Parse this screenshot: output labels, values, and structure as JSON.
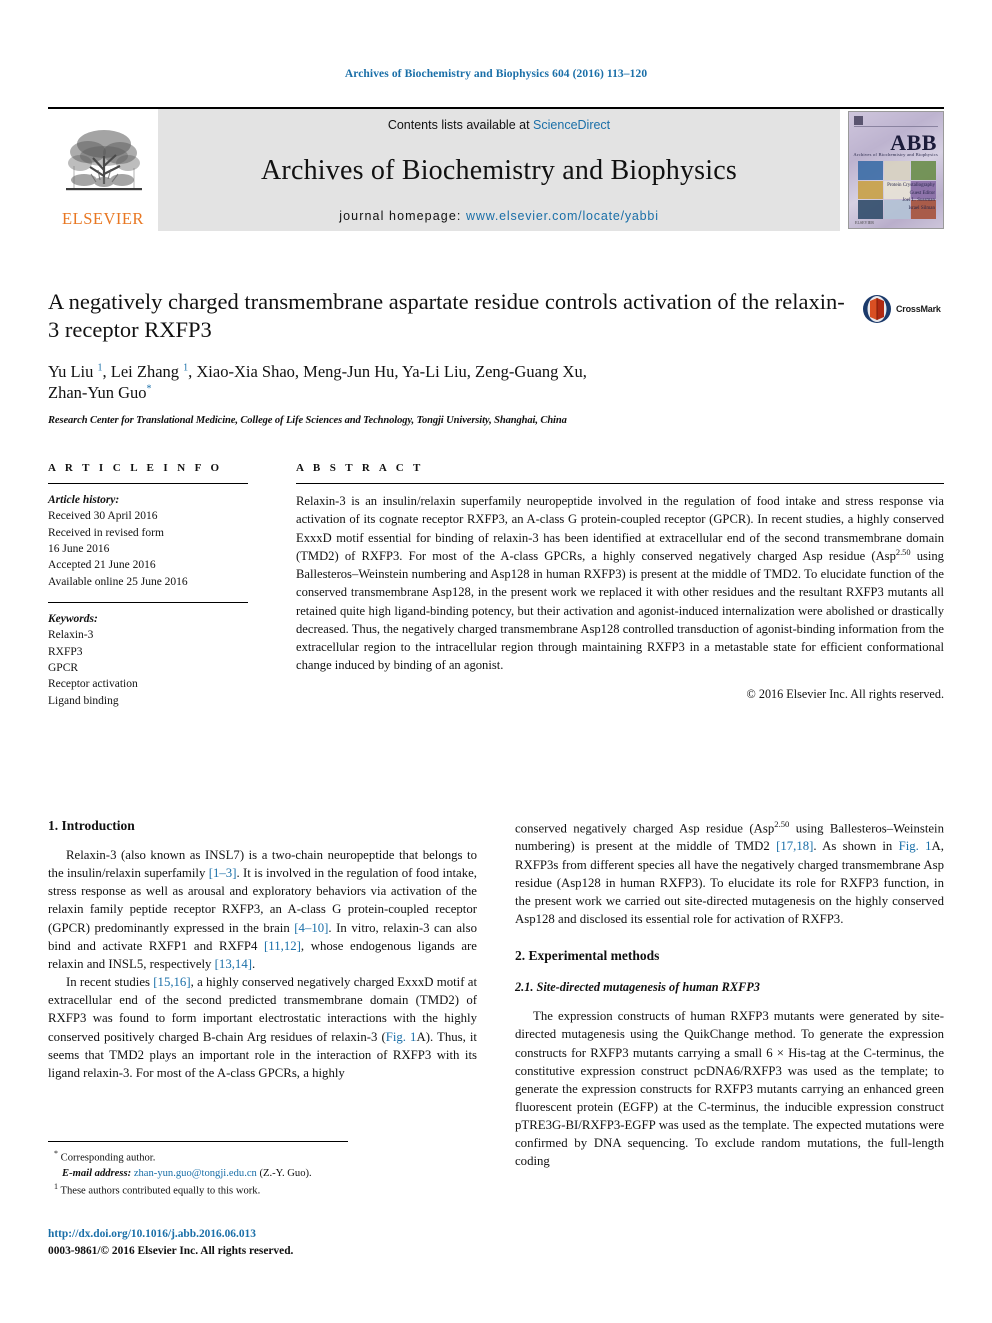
{
  "running_head": "Archives of Biochemistry and Biophysics 604 (2016) 113–120",
  "masthead": {
    "publisher_logo_label": "ELSEVIER",
    "contents_prefix": "Contents lists available at",
    "contents_link": "ScienceDirect",
    "journal_title": "Archives of Biochemistry and Biophysics",
    "homepage_prefix": "journal homepage:",
    "homepage_url": "www.elsevier.com/locate/yabbi",
    "cover": {
      "acronym": "ABB",
      "subtitle": "Archives of Biochemistry and Biophysics",
      "footer_line1": "Protein Crystallography",
      "footer_line2": "Guest Editor",
      "footer_line3": "Joel L. Sussman",
      "footer_line4": "Israel Silman",
      "publisher": "ELSEVIER"
    }
  },
  "article": {
    "title": "A negatively charged transmembrane aspartate residue controls activation of the relaxin-3 receptor RXFP3",
    "authors_line1": "Yu Liu",
    "authors": "Yu Liu ¹, Lei Zhang ¹, Xiao-Xia Shao, Meng-Jun Hu, Ya-Li Liu, Zeng-Guang Xu, Zhan-Yun Guo",
    "affiliation": "Research Center for Translational Medicine, College of Life Sciences and Technology, Tongji University, Shanghai, China",
    "crossmark_label": "CrossMark"
  },
  "article_info": {
    "heading": "A R T I C L E   I N F O",
    "history_label": "Article history:",
    "history": [
      "Received 30 April 2016",
      "Received in revised form",
      "16 June 2016",
      "Accepted 21 June 2016",
      "Available online 25 June 2016"
    ],
    "keywords_label": "Keywords:",
    "keywords": [
      "Relaxin-3",
      "RXFP3",
      "GPCR",
      "Receptor activation",
      "Ligand binding"
    ]
  },
  "abstract": {
    "heading": "A B S T R A C T",
    "body_part1": "Relaxin-3 is an insulin/relaxin superfamily neuropeptide involved in the regulation of food intake and stress response via activation of its cognate receptor RXFP3, an A-class G protein-coupled receptor (GPCR). In recent studies, a highly conserved ExxxD motif essential for binding of relaxin-3 has been identified at extracellular end of the second transmembrane domain (TMD2) of RXFP3. For most of the A-class GPCRs, a highly conserved negatively charged Asp residue (Asp",
    "sup": "2.50",
    "body_part2": " using Ballesteros–Weinstein numbering and Asp128 in human RXFP3) is present at the middle of TMD2. To elucidate function of the conserved transmembrane Asp128, in the present work we replaced it with other residues and the resultant RXFP3 mutants all retained quite high ligand-binding potency, but their activation and agonist-induced internalization were abolished or drastically decreased. Thus, the negatively charged transmembrane Asp128 controlled transduction of agonist-binding information from the extracellular region to the intracellular region through maintaining RXFP3 in a metastable state for efficient conformational change induced by binding of an agonist.",
    "copyright": "© 2016 Elsevier Inc. All rights reserved."
  },
  "sections": {
    "intro_heading": "1.  Introduction",
    "intro_p1_a": "Relaxin-3 (also known as INSL7) is a two-chain neuropeptide that belongs to the insulin/relaxin superfamily ",
    "intro_p1_ref1": "[1–3]",
    "intro_p1_b": ". It is involved in the regulation of food intake, stress response as well as arousal and exploratory behaviors via activation of the relaxin family peptide receptor RXFP3, an A-class G protein-coupled receptor (GPCR) predominantly expressed in the brain ",
    "intro_p1_ref2": "[4–10]",
    "intro_p1_c": ". In vitro, relaxin-3 can also bind and activate RXFP1 and RXFP4 ",
    "intro_p1_ref3": "[11,12]",
    "intro_p1_d": ", whose endogenous ligands are relaxin and INSL5, respectively ",
    "intro_p1_ref4": "[13,14]",
    "intro_p1_e": ".",
    "intro_p2_a": "In recent studies ",
    "intro_p2_ref1": "[15,16]",
    "intro_p2_b": ", a highly conserved negatively charged ExxxD motif at extracellular end of the second predicted transmembrane domain (TMD2) of RXFP3 was found to form important electrostatic interactions with the highly conserved positively charged B-chain Arg residues of relaxin-3 (",
    "intro_p2_ref2": "Fig. 1",
    "intro_p2_c": "A). Thus, it seems that TMD2 plays an important role in the interaction of RXFP3 with its ligand relaxin-3. For most of the A-class GPCRs, a highly",
    "right_p1_a": "conserved negatively charged Asp residue (Asp",
    "right_p1_sup": "2.50",
    "right_p1_b": " using Ballesteros–Weinstein numbering) is present at the middle of TMD2 ",
    "right_p1_ref1": "[17,18]",
    "right_p1_c": ". As shown in ",
    "right_p1_ref2": "Fig. 1",
    "right_p1_d": "A, RXFP3s from different species all have the negatively charged transmembrane Asp residue (Asp128 in human RXFP3). To elucidate its role for RXFP3 function, in the present work we carried out site-directed mutagenesis on the highly conserved Asp128 and disclosed its essential role for activation of RXFP3.",
    "methods_heading": "2.  Experimental methods",
    "methods_sub_heading": "2.1.  Site-directed mutagenesis of human RXFP3",
    "methods_p1": "The expression constructs of human RXFP3 mutants were generated by site-directed mutagenesis using the QuikChange method. To generate the expression constructs for RXFP3 mutants carrying a small 6 × His-tag at the C-terminus, the constitutive expression construct pcDNA6/RXFP3 was used as the template; to generate the expression constructs for RXFP3 mutants carrying an enhanced green fluorescent protein (EGFP) at the C-terminus, the inducible expression construct pTRE3G-BI/RXFP3-EGFP was used as the template. The expected mutations were confirmed by DNA sequencing. To exclude random mutations, the full-length coding"
  },
  "footnotes": {
    "corresponding_marker": "*",
    "corresponding_text": "Corresponding author.",
    "email_label": "E-mail address:",
    "email": "zhan-yun.guo@tongji.edu.cn",
    "email_suffix": "(Z.-Y. Guo).",
    "equal_marker": "1",
    "equal_text": "These authors contributed equally to this work."
  },
  "footer": {
    "doi": "http://dx.doi.org/10.1016/j.abb.2016.06.013",
    "issn_line": "0003-9861/© 2016 Elsevier Inc. All rights reserved."
  },
  "colors": {
    "link_blue": "#1a6fa8",
    "elsevier_orange": "#E87722",
    "band_gray": "#e3e3e3"
  }
}
